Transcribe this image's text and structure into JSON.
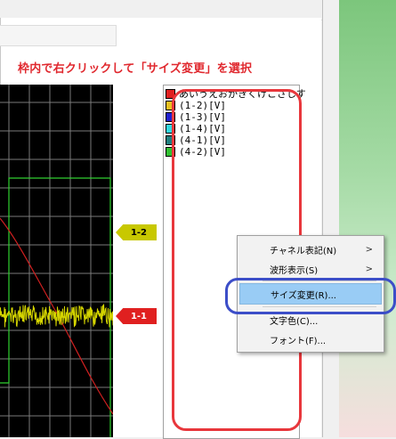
{
  "instruction": "枠内で右クリックして「サイズ変更」を選択",
  "legend": {
    "items": [
      {
        "label": "あいうえおかきくけこさしす",
        "color": "#e02020"
      },
      {
        "label": "(1-2)[V]",
        "color": "#e8c020"
      },
      {
        "label": "(1-3)[V]",
        "color": "#2020d0"
      },
      {
        "label": "(1-4)[V]",
        "color": "#30d8e0"
      },
      {
        "label": "(4-1)[V]",
        "color": "#208080"
      },
      {
        "label": "(4-2)[V]",
        "color": "#30c030"
      }
    ]
  },
  "markers": {
    "m12": {
      "label": "1-2",
      "color": "#c8c800"
    },
    "m11": {
      "label": "1-1",
      "color": "#e02020"
    }
  },
  "context_menu": {
    "items": [
      {
        "label": "チャネル表記(N)",
        "has_submenu": true
      },
      {
        "label": "波形表示(S)",
        "has_submenu": true
      },
      {
        "label": "サイズ変更(R)...",
        "selected": true
      },
      {
        "label": "文字色(C)..."
      },
      {
        "label": "フォント(F)..."
      }
    ],
    "submenu_arrow": ">"
  },
  "colors": {
    "annotation_red": "#e8373c",
    "annotation_blue": "#3c4ec8",
    "grid": "#7a7a7a",
    "trace_yellow": "#d4d400",
    "trace_red": "#d02020",
    "trace_green": "#30d030"
  }
}
